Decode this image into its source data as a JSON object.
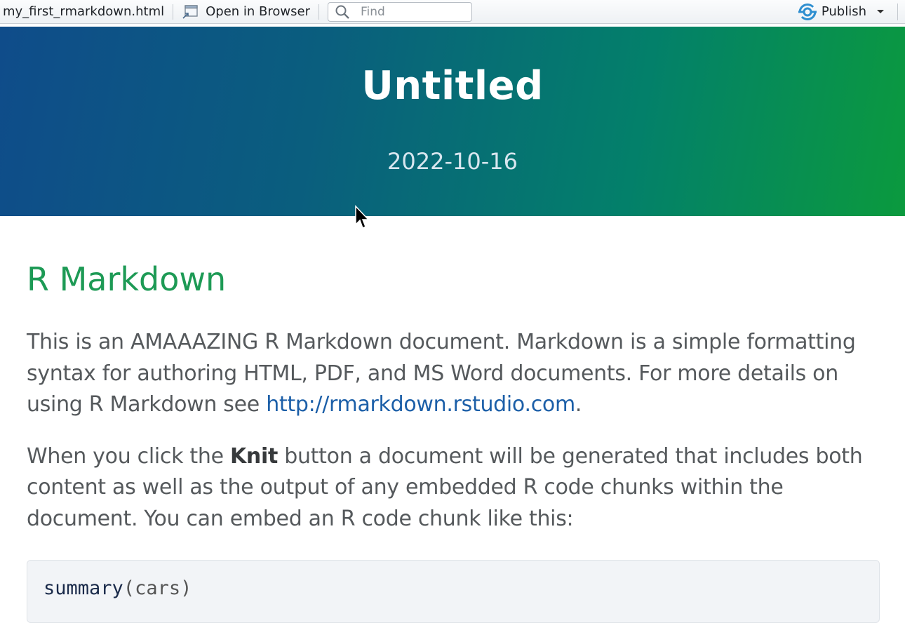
{
  "toolbar": {
    "filename": "my_first_rmarkdown.html",
    "open_browser_label": "Open in Browser",
    "find_placeholder": "Find",
    "publish_label": "Publish"
  },
  "document": {
    "title": "Untitled",
    "date": "2022-10-16",
    "heading": "R Markdown",
    "para1_text": "This is an AMAAAZING R Markdown document. Markdown is a simple formatting syntax for authoring HTML, PDF, and MS Word documents. For more details on using R Markdown see ",
    "para1_link": "http://rmarkdown.rstudio.com",
    "para1_end": ".",
    "para2_start": "When you click the ",
    "para2_bold": "Knit",
    "para2_end": " button a document will be generated that includes both content as well as the output of any embedded R code chunks within the document. You can embed an R code chunk like this:",
    "code_fn": "summary",
    "code_open": "(",
    "code_arg": "cars",
    "code_close": ")"
  },
  "colors": {
    "banner_start": "#0f4c8a",
    "banner_end": "#0b9a3e",
    "heading": "#1d9a55",
    "link": "#1c5fa8"
  },
  "icons": [
    "open-in-browser-icon",
    "search-icon",
    "publish-icon",
    "chevron-down-icon",
    "mouse-cursor"
  ]
}
